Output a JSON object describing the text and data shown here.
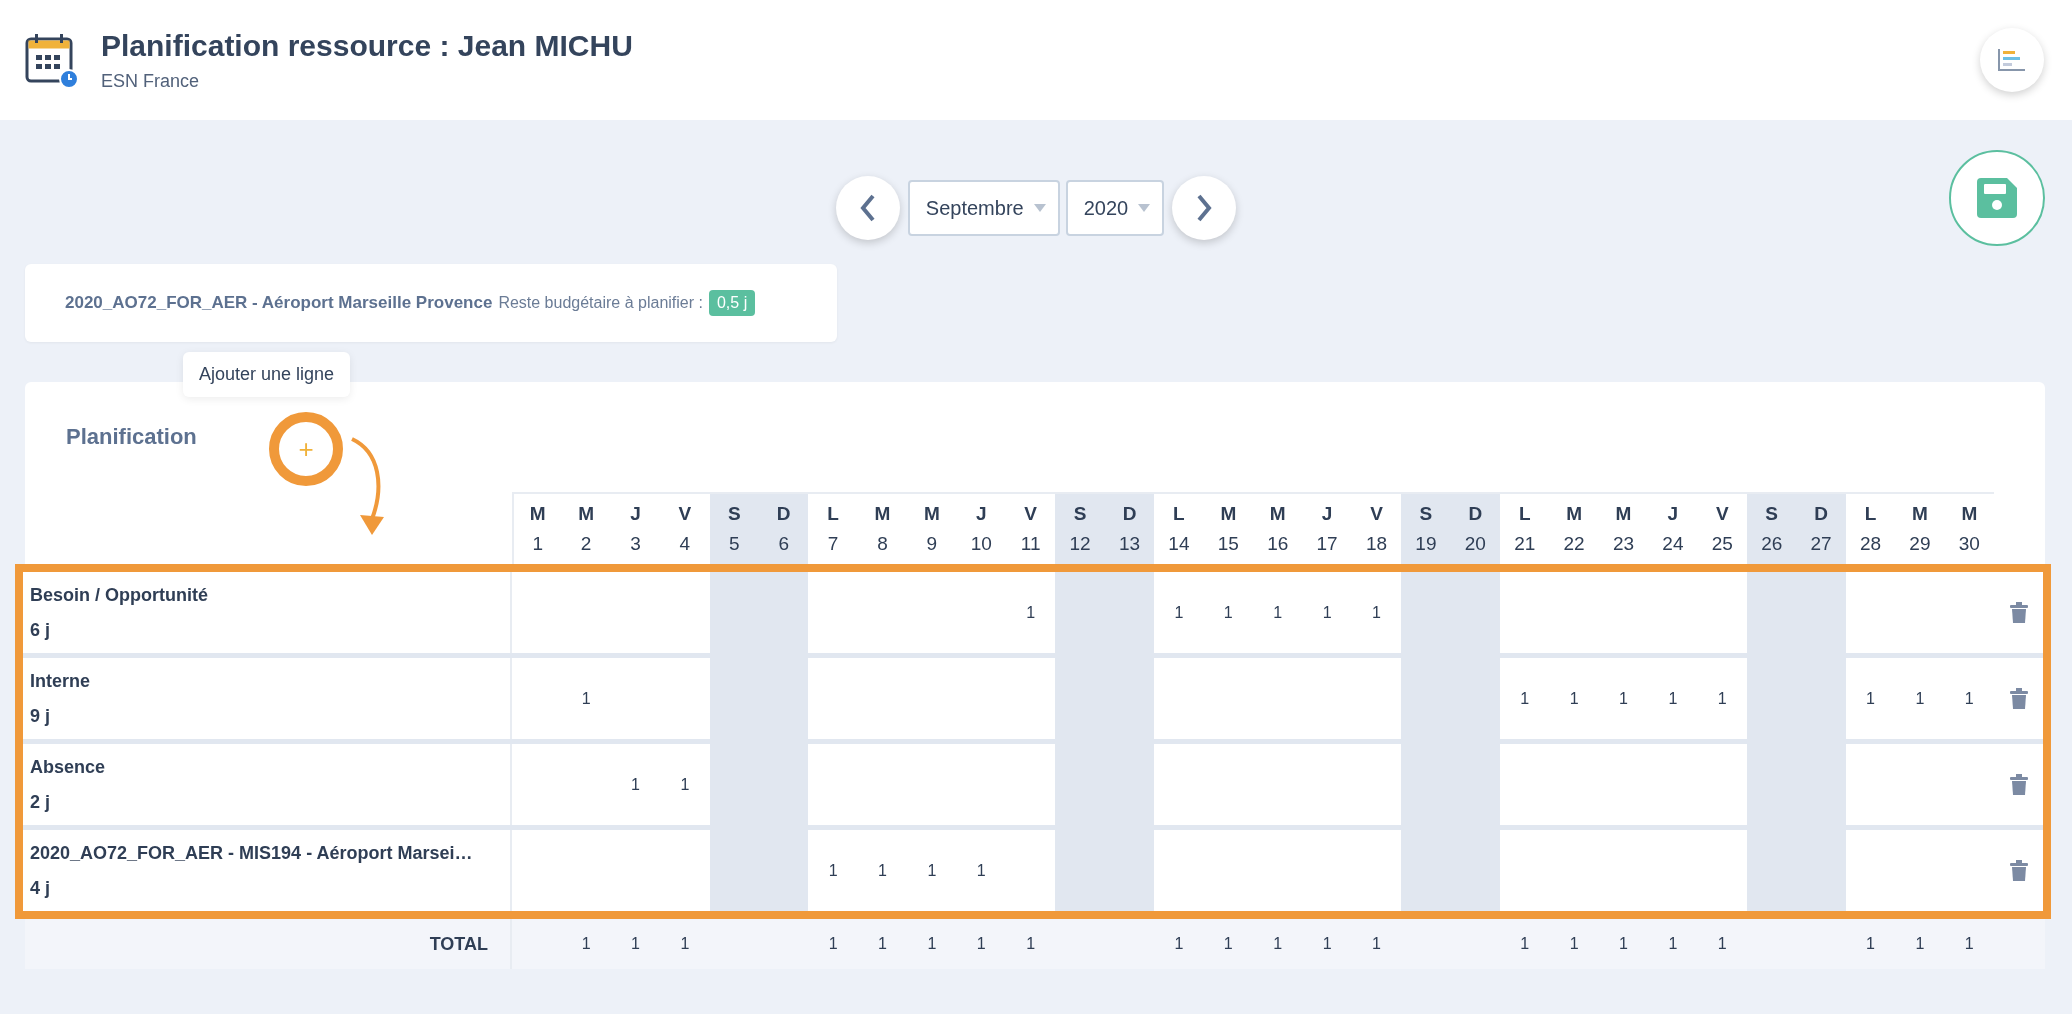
{
  "header": {
    "title": "Planification ressource : Jean MICHU",
    "subtitle": "ESN France"
  },
  "period": {
    "month": "Septembre",
    "year": "2020"
  },
  "budget": {
    "project": "2020_AO72_FOR_AER - Aéroport Marseille Provence",
    "label": "Reste budgétaire à planifier :",
    "remaining": "0,5 j"
  },
  "planning": {
    "title": "Planification",
    "add_button": "+",
    "add_tooltip": "Ajouter une ligne",
    "days": [
      {
        "letter": "M",
        "number": "1",
        "weekend": false
      },
      {
        "letter": "M",
        "number": "2",
        "weekend": false
      },
      {
        "letter": "J",
        "number": "3",
        "weekend": false
      },
      {
        "letter": "V",
        "number": "4",
        "weekend": false
      },
      {
        "letter": "S",
        "number": "5",
        "weekend": true
      },
      {
        "letter": "D",
        "number": "6",
        "weekend": true
      },
      {
        "letter": "L",
        "number": "7",
        "weekend": false
      },
      {
        "letter": "M",
        "number": "8",
        "weekend": false
      },
      {
        "letter": "M",
        "number": "9",
        "weekend": false
      },
      {
        "letter": "J",
        "number": "10",
        "weekend": false
      },
      {
        "letter": "V",
        "number": "11",
        "weekend": false
      },
      {
        "letter": "S",
        "number": "12",
        "weekend": true
      },
      {
        "letter": "D",
        "number": "13",
        "weekend": true
      },
      {
        "letter": "L",
        "number": "14",
        "weekend": false
      },
      {
        "letter": "M",
        "number": "15",
        "weekend": false
      },
      {
        "letter": "M",
        "number": "16",
        "weekend": false
      },
      {
        "letter": "J",
        "number": "17",
        "weekend": false
      },
      {
        "letter": "V",
        "number": "18",
        "weekend": false
      },
      {
        "letter": "S",
        "number": "19",
        "weekend": true
      },
      {
        "letter": "D",
        "number": "20",
        "weekend": true
      },
      {
        "letter": "L",
        "number": "21",
        "weekend": false
      },
      {
        "letter": "M",
        "number": "22",
        "weekend": false
      },
      {
        "letter": "M",
        "number": "23",
        "weekend": false
      },
      {
        "letter": "J",
        "number": "24",
        "weekend": false
      },
      {
        "letter": "V",
        "number": "25",
        "weekend": false
      },
      {
        "letter": "S",
        "number": "26",
        "weekend": true
      },
      {
        "letter": "D",
        "number": "27",
        "weekend": true
      },
      {
        "letter": "L",
        "number": "28",
        "weekend": false
      },
      {
        "letter": "M",
        "number": "29",
        "weekend": false
      },
      {
        "letter": "M",
        "number": "30",
        "weekend": false
      }
    ],
    "rows": [
      {
        "name": "Besoin / Opportunité",
        "total": "6 j",
        "cells": [
          null,
          null,
          null,
          null,
          null,
          null,
          null,
          null,
          null,
          null,
          "1",
          null,
          null,
          "1",
          "1",
          "1",
          "1",
          "1",
          null,
          null,
          null,
          null,
          null,
          null,
          null,
          null,
          null,
          null,
          null,
          null
        ]
      },
      {
        "name": "Interne",
        "total": "9 j",
        "cells": [
          null,
          "1",
          null,
          null,
          null,
          null,
          null,
          null,
          null,
          null,
          null,
          null,
          null,
          null,
          null,
          null,
          null,
          null,
          null,
          null,
          "1",
          "1",
          "1",
          "1",
          "1",
          null,
          null,
          "1",
          "1",
          "1"
        ]
      },
      {
        "name": "Absence",
        "total": "2 j",
        "cells": [
          null,
          null,
          "1",
          "1",
          null,
          null,
          null,
          null,
          null,
          null,
          null,
          null,
          null,
          null,
          null,
          null,
          null,
          null,
          null,
          null,
          null,
          null,
          null,
          null,
          null,
          null,
          null,
          null,
          null,
          null
        ]
      },
      {
        "name": "2020_AO72_FOR_AER - MIS194 - Aéroport Marsei…",
        "total": "4 j",
        "cells": [
          null,
          null,
          null,
          null,
          null,
          null,
          "1",
          "1",
          "1",
          "1",
          null,
          null,
          null,
          null,
          null,
          null,
          null,
          null,
          null,
          null,
          null,
          null,
          null,
          null,
          null,
          null,
          null,
          null,
          null,
          null
        ]
      }
    ],
    "total": {
      "label": "TOTAL",
      "cells": [
        null,
        "1",
        "1",
        "1",
        null,
        null,
        "1",
        "1",
        "1",
        "1",
        "1",
        null,
        null,
        "1",
        "1",
        "1",
        "1",
        "1",
        null,
        null,
        "1",
        "1",
        "1",
        "1",
        "1",
        null,
        null,
        "1",
        "1",
        "1"
      ]
    }
  }
}
